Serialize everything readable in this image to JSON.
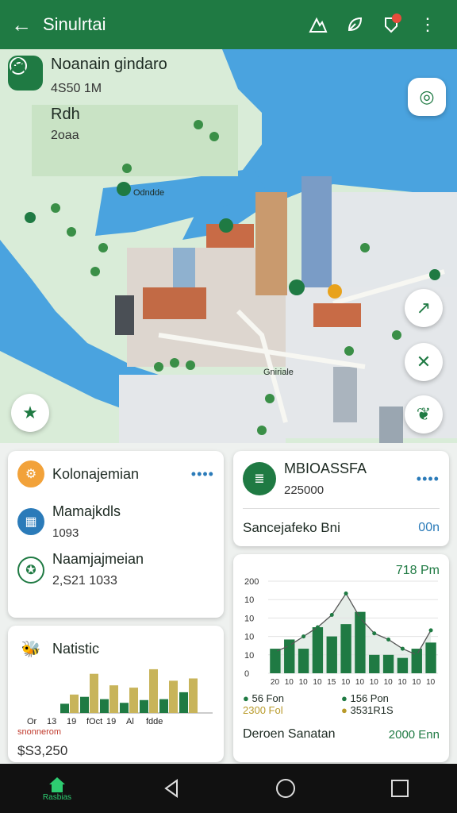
{
  "app": {
    "title": "Sinulrtai"
  },
  "map": {
    "place_title": "Noanain gindaro",
    "place_value": "4S50 1M",
    "sub_title": "Rdh",
    "sub_value": "2oaa",
    "labels": [
      "Odndde",
      "Gniriale"
    ]
  },
  "cards": {
    "left1": {
      "items": [
        {
          "title": "Kolonajemian",
          "value": ""
        },
        {
          "title": "Mamajkdls",
          "value": "1093"
        },
        {
          "title": "Naamjajmeian",
          "value": "2,S21 1033"
        }
      ]
    },
    "right1": {
      "title": "MBIOASSFA",
      "value": "225000",
      "footer_label": "Sancejafeko Bni",
      "footer_value": "00n"
    },
    "left2": {
      "title": "Natistic",
      "x_labels": [
        "Or",
        "13",
        "19",
        "fOct",
        "19",
        "Al",
        "fdde"
      ],
      "legend": "snonnerom",
      "total": "$S3,250"
    },
    "right2": {
      "header_value": "718 Pm",
      "legend_a_label": "56 Fon",
      "legend_a_value": "2300 Fol",
      "legend_b_label": "156 Pon",
      "legend_b_value": "3531R1S",
      "footer_label": "Deroen Sanatan",
      "footer_value": "2000 Enn"
    }
  },
  "nav": {
    "home_label": "Rasbias"
  },
  "chart_data": [
    {
      "type": "bar",
      "title": "Natistic",
      "categories": [
        "Or",
        "13",
        "19",
        "fOct",
        "19",
        "Al",
        "fdde"
      ],
      "series": [
        {
          "values": [
            20,
            35,
            30,
            22,
            28,
            30,
            45
          ]
        },
        {
          "values": [
            40,
            85,
            60,
            55,
            95,
            70,
            75
          ]
        }
      ],
      "ylim": [
        0,
        100
      ]
    },
    {
      "type": "bar",
      "categories": [
        "20",
        "10",
        "10",
        "10",
        "15",
        "10",
        "10",
        "10",
        "10",
        "10",
        "10",
        "10"
      ],
      "y_ticks": [
        "0",
        "10",
        "10",
        "10",
        "10",
        "200"
      ],
      "values": [
        40,
        55,
        40,
        75,
        60,
        80,
        100,
        30,
        30,
        25,
        40,
        50
      ],
      "line_values": [
        35,
        45,
        60,
        75,
        95,
        130,
        90,
        65,
        55,
        40,
        30,
        70
      ],
      "ylim": [
        0,
        150
      ]
    }
  ],
  "colors": {
    "primary": "#1f7a43",
    "accent": "#2b7bb9",
    "gold": "#c8b45a",
    "water": "#4aa3df"
  }
}
